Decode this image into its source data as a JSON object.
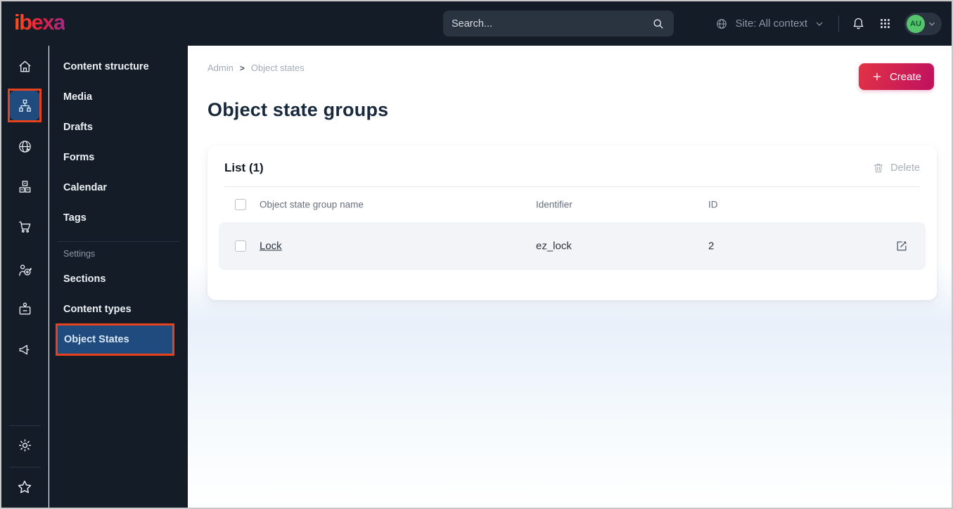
{
  "topbar": {
    "logo_text": "ibexa",
    "search": {
      "placeholder": "Search..."
    },
    "site_selector": {
      "label": "Site: All context"
    },
    "avatar": {
      "initials": "AU"
    }
  },
  "icon_rail": {
    "items": [
      "home",
      "content-structure",
      "site",
      "product-catalog",
      "commerce",
      "personalization",
      "corporate",
      "campaign"
    ],
    "bottom_items": [
      "settings",
      "bookmarks"
    ],
    "active_item": "content-structure"
  },
  "sidebar": {
    "items": [
      {
        "label": "Content structure"
      },
      {
        "label": "Media"
      },
      {
        "label": "Drafts"
      },
      {
        "label": "Forms"
      },
      {
        "label": "Calendar"
      },
      {
        "label": "Tags"
      }
    ],
    "section_label": "Settings",
    "settings_items": [
      {
        "label": "Sections"
      },
      {
        "label": "Content types"
      },
      {
        "label": "Object States",
        "active": true
      }
    ]
  },
  "main": {
    "breadcrumb": {
      "items": [
        "Admin",
        "Object states"
      ],
      "separator": ">"
    },
    "create_button": "Create",
    "page_title": "Object state groups",
    "list_card": {
      "title": "List (1)",
      "delete_button": "Delete",
      "columns": [
        "Object state group name",
        "Identifier",
        "ID"
      ],
      "rows": [
        {
          "name": "Lock",
          "identifier": "ez_lock",
          "id": "2"
        }
      ]
    }
  },
  "colors": {
    "topbar_bg": "#141c28",
    "active_blue": "#1f4b7f",
    "annotation_orange": "#e8421d",
    "create_gradient_start": "#e23345",
    "create_gradient_end": "#bf1060",
    "avatar_green": "#55c46d"
  }
}
